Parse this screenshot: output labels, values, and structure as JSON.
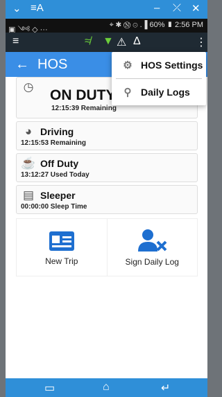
{
  "window": {
    "title": "≡A",
    "minimize": "–",
    "maximize": "⤫",
    "close": "✕",
    "chevron": "⌄"
  },
  "status": {
    "left": "▣ ༺ ◇ ···",
    "right": "⌖ ✱ Ⓝ ⊙ .▐ 60% ▮ 2:56 PM"
  },
  "toolbar": {
    "menu": "≡",
    "rss": "≉",
    "location": "▼",
    "alert": "⚠",
    "extinguisher": "Δ",
    "more": "⋮"
  },
  "header": {
    "back": "←",
    "title": "HOS"
  },
  "duty": {
    "status": "ON DUTY",
    "remaining": "12:15:39 Remaining"
  },
  "statuses": [
    {
      "title": "Driving",
      "sub": "12:15:53 Remaining"
    },
    {
      "title": "Off Duty",
      "sub": "13:12:27 Used Today"
    },
    {
      "title": "Sleeper",
      "sub": "00:00:00 Sleep Time"
    }
  ],
  "actions": {
    "new_trip": "New Trip",
    "sign_daily_log": "Sign Daily Log"
  },
  "menu": {
    "hos_settings": "HOS Settings",
    "daily_logs": "Daily Logs"
  },
  "navbar": {
    "recent": "▭",
    "home": "⌂",
    "back": "↵"
  },
  "colors": {
    "accent": "#3a8ee6",
    "toolbar": "#1f2a33",
    "navbar": "#2f8fd8"
  }
}
